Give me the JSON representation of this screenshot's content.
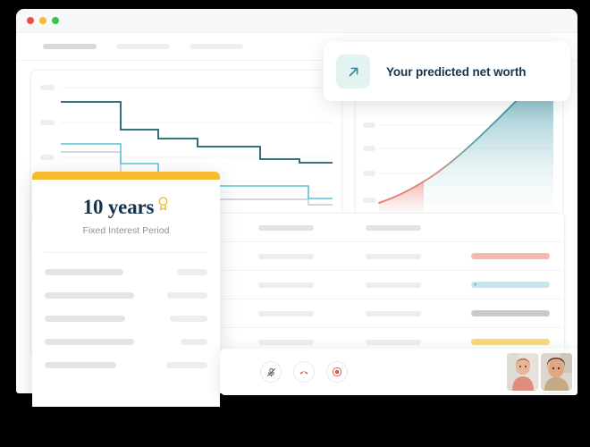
{
  "window": {
    "traffic_lights": [
      {
        "name": "close",
        "color": "#ef4f47"
      },
      {
        "name": "minimize",
        "color": "#f5bb2e"
      },
      {
        "name": "maximize",
        "color": "#34c548"
      }
    ],
    "tabs": [
      {
        "label": "",
        "width": 60,
        "active": true
      },
      {
        "label": "",
        "width": 60,
        "active": false
      },
      {
        "label": "",
        "width": 60,
        "active": false
      }
    ]
  },
  "networth_card": {
    "title": "Your predicted net worth",
    "icon": "arrow-up-right-icon",
    "icon_color": "#2b8a9b",
    "icon_bg": "#e3f3f1"
  },
  "years_card": {
    "accent_color": "#f5bb33",
    "title": "10 years",
    "medal_icon": "medal-icon",
    "subtitle": "Fixed Interest Period",
    "rows": [
      {
        "left_width": 88,
        "right_width": 34
      },
      {
        "left_width": 100,
        "right_width": 45
      },
      {
        "left_width": 90,
        "right_width": 42
      },
      {
        "left_width": 100,
        "right_width": 30
      },
      {
        "left_width": 80,
        "right_width": 46
      }
    ]
  },
  "table": {
    "columns": [
      "",
      "",
      "",
      ""
    ],
    "rows": [
      {
        "cells": [
          "",
          "",
          "",
          ""
        ],
        "status": null,
        "header": true
      },
      {
        "cells": [
          "",
          "",
          "",
          ""
        ],
        "status": {
          "color": "red",
          "icon": null
        }
      },
      {
        "cells": [
          "",
          "",
          "",
          ""
        ],
        "status": {
          "color": "cyan",
          "icon": "star-icon"
        }
      },
      {
        "cells": [
          "",
          "",
          "",
          ""
        ],
        "status": {
          "color": "gray",
          "icon": null
        }
      },
      {
        "cells": [
          "",
          "",
          "",
          ""
        ],
        "status": {
          "color": "yellow",
          "icon": null
        }
      }
    ],
    "status_colors": {
      "red": "#f6b7ae",
      "cyan": "#c3e8f0",
      "gray": "#c7cbd0",
      "yellow": "#fbd97a"
    }
  },
  "callbar": {
    "controls": [
      {
        "name": "mute-microphone-button",
        "icon": "microphone-muted-icon",
        "color": "#3d5566"
      },
      {
        "name": "end-call-button",
        "icon": "phone-hangup-icon",
        "color": "#e05a4e"
      },
      {
        "name": "record-button",
        "icon": "record-icon",
        "color": "#e05a4e"
      }
    ],
    "participants": [
      {
        "name": "participant-1",
        "active": false
      },
      {
        "name": "participant-2",
        "active": true
      }
    ]
  },
  "chart_data": [
    {
      "id": "interest-rate-step-chart",
      "type": "line",
      "title": "",
      "xlabel": "",
      "ylabel": "",
      "grid": true,
      "legend": "none",
      "axis_labels_placeholder": true,
      "ytick_count": 4,
      "xtick_count": 3,
      "xlim": [
        0,
        100
      ],
      "ylim": [
        0,
        100
      ],
      "series": [
        {
          "name": "dark-teal-step",
          "color": "#1b5e6d",
          "step": true,
          "x": [
            0,
            15,
            15,
            31,
            31,
            45,
            45,
            75,
            75,
            88,
            88,
            100
          ],
          "y": [
            82,
            82,
            59,
            59,
            52,
            52,
            45,
            45,
            33,
            33,
            28,
            28
          ]
        },
        {
          "name": "cyan-step",
          "color": "#5bc4da",
          "step": true,
          "x": [
            0,
            15,
            15,
            31,
            31,
            47,
            47,
            62,
            62,
            88,
            88,
            100
          ],
          "y": [
            49,
            49,
            32,
            32,
            25,
            25,
            18,
            18,
            16,
            16,
            9,
            9
          ]
        },
        {
          "name": "gray-step",
          "color": "#c3cbd2",
          "step": true,
          "x": [
            0,
            15,
            15,
            88,
            88,
            100
          ],
          "y": [
            43,
            43,
            6,
            6,
            4,
            4
          ]
        }
      ]
    },
    {
      "id": "predicted-net-worth-chart",
      "type": "area",
      "title": "",
      "xlabel": "",
      "ylabel": "",
      "grid": true,
      "legend": "none",
      "axis_labels_placeholder": true,
      "ytick_count": 5,
      "xtick_count": 8,
      "xlim": [
        0,
        100
      ],
      "ylim": [
        0,
        100
      ],
      "line_gradient": [
        "#e8736a",
        "#2b8a9b"
      ],
      "fill_gradient_top": "#2b8a9b",
      "fill_gradient_bottom": "#ffffff",
      "x": [
        0,
        12,
        25,
        37,
        50,
        62,
        75,
        87,
        100
      ],
      "y": [
        6,
        10,
        15,
        22,
        32,
        45,
        60,
        78,
        98
      ]
    }
  ]
}
